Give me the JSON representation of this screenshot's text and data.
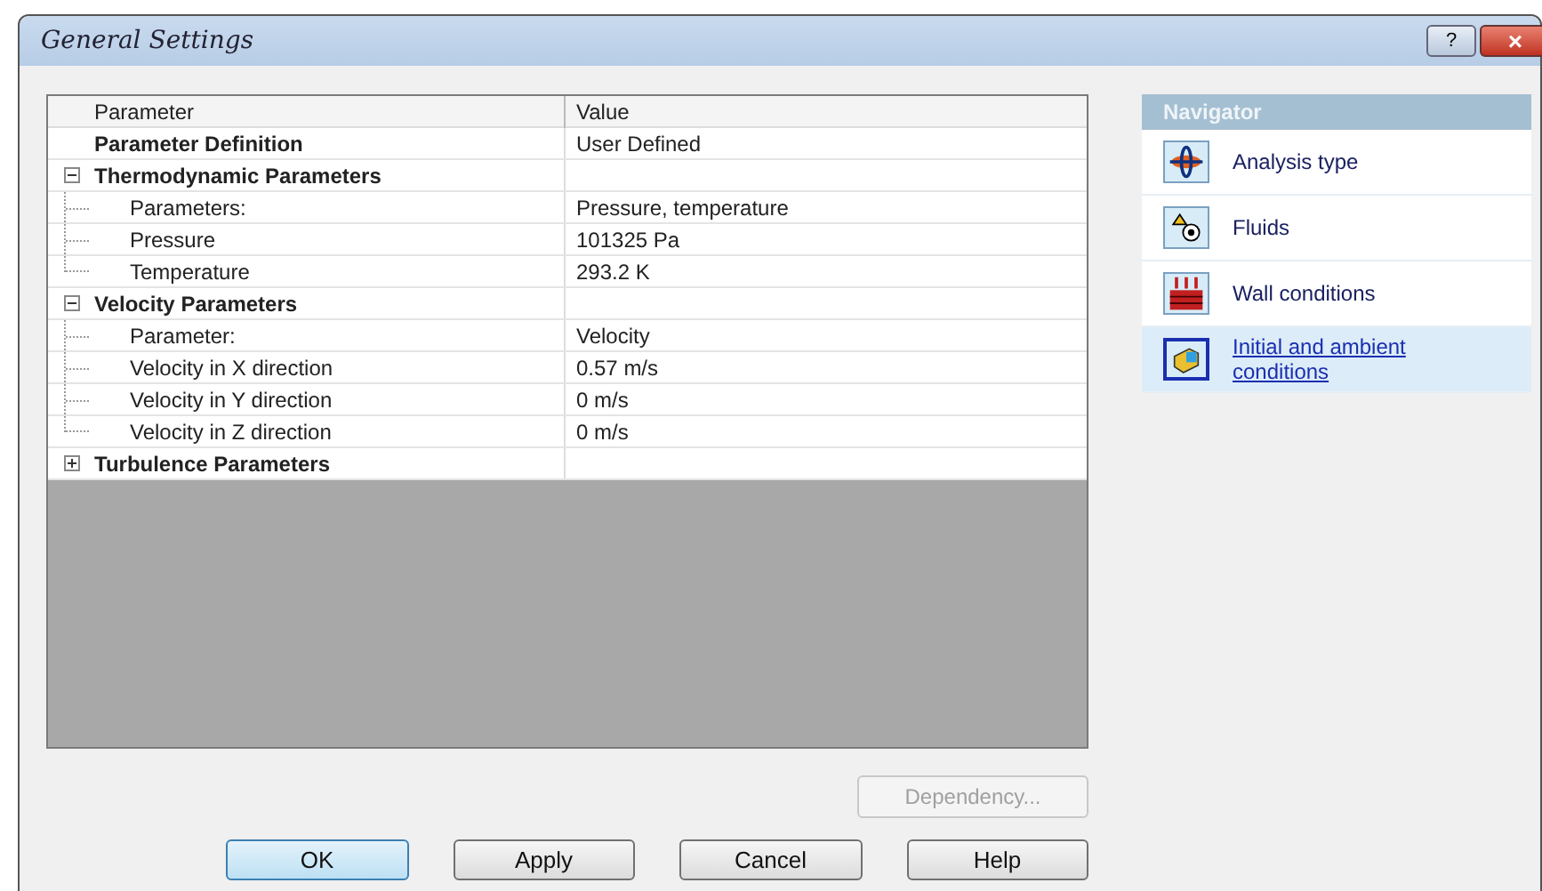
{
  "window": {
    "title": "General Settings",
    "buttons": [
      "?",
      "×"
    ]
  },
  "table": {
    "columns": [
      "Parameter",
      "Value"
    ],
    "rows": [
      {
        "kind": "heading",
        "name": "Parameter Definition",
        "value": "User Defined"
      },
      {
        "kind": "group",
        "name": "Thermodynamic Parameters",
        "expanded": true,
        "children": [
          {
            "name": "Parameters:",
            "value": "Pressure, temperature"
          },
          {
            "name": "Pressure",
            "value": "101325 Pa"
          },
          {
            "name": "Temperature",
            "value": "293.2 K"
          }
        ]
      },
      {
        "kind": "group",
        "name": "Velocity Parameters",
        "expanded": true,
        "children": [
          {
            "name": "Parameter:",
            "value": "Velocity"
          },
          {
            "name": "Velocity in X direction",
            "value": "0.57 m/s"
          },
          {
            "name": "Velocity in Y direction",
            "value": "0 m/s"
          },
          {
            "name": "Velocity in Z direction",
            "value": "0 m/s"
          }
        ]
      },
      {
        "kind": "group",
        "name": "Turbulence Parameters",
        "expanded": false,
        "children": []
      }
    ]
  },
  "dependency_button": {
    "label": "Dependency...",
    "disabled": true
  },
  "buttons": [
    {
      "label": "OK",
      "default": true
    },
    {
      "label": "Apply",
      "default": false
    },
    {
      "label": "Cancel",
      "default": false
    },
    {
      "label": "Help",
      "default": false
    }
  ],
  "navigator": {
    "title": "Navigator",
    "items": [
      {
        "kind": "analysis",
        "label": "Analysis type",
        "selected": false
      },
      {
        "kind": "fluids",
        "label": "Fluids",
        "selected": false
      },
      {
        "kind": "wall",
        "label": "Wall conditions",
        "selected": false
      },
      {
        "kind": "initial",
        "label": "Initial and ambient conditions",
        "selected": true
      }
    ]
  }
}
